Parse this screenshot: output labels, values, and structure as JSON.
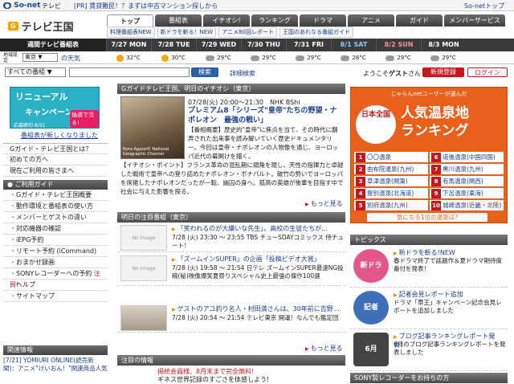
{
  "topbar": {
    "logo": "So-net",
    "tv": "テレビ",
    "pr": "[PR] 賃貸難民！？まずは中古マンション探しから",
    "right_link": "So-netトップ"
  },
  "brand": {
    "badge": "G",
    "name": "テレビ王国"
  },
  "nav": {
    "tabs": [
      "トップ",
      "番組表",
      "イチオシ!",
      "ランキング",
      "ドラマ",
      "アニメ",
      "ガイド",
      "メンバーサービス"
    ]
  },
  "subnav": {
    "items": [
      "料理番組表NEW",
      "新ドラを斬る！NEW",
      "アニメ80回レポート",
      "王国のあれなる番組ガイド"
    ]
  },
  "week": {
    "caption": "週間テレビ番組表",
    "days": [
      {
        "date": "7/27",
        "dow": "MON",
        "type": "wk"
      },
      {
        "date": "7/28",
        "dow": "TUE",
        "type": "wk"
      },
      {
        "date": "7/29",
        "dow": "WED",
        "type": "wk"
      },
      {
        "date": "7/30",
        "dow": "THU",
        "type": "wk"
      },
      {
        "date": "7/31",
        "dow": "FRI",
        "type": "wk"
      },
      {
        "date": "8/1",
        "dow": "SAT",
        "type": "sat"
      },
      {
        "date": "8/2",
        "dow": "SUN",
        "type": "sun"
      },
      {
        "date": "8/3",
        "dow": "MON",
        "type": "wk"
      }
    ]
  },
  "weather": {
    "area_label": "地域設定",
    "area": "東京",
    "link": "の天気",
    "temps": [
      "32°C",
      "30°C",
      "29°C",
      "29°C",
      "29°C",
      "28°C",
      "29°C",
      "29°C"
    ],
    "icons": [
      "sun-icon",
      "sun-icon",
      "cloud-icon",
      "cloud-icon",
      "cloud-icon",
      "cloud-icon",
      "cloud-icon",
      "cloud-icon"
    ]
  },
  "search": {
    "scope": "すべての番組",
    "button": "検索",
    "advanced": "詳細検索",
    "welcome_prefix": "ようこそ",
    "welcome_name": "ゲスト",
    "welcome_suffix": "さん",
    "register": "新規登録",
    "login": "ログイン"
  },
  "left": {
    "banner": {
      "line1": "リニューアル",
      "line2": "キャンペーン",
      "tag": "抽選で当る!",
      "small": "応募締切 8/31"
    },
    "banner_link": "番組表が新しくなりました",
    "guide_title": "Gガイド・テレビ王国とは？",
    "info_items": [
      "初めての方へ",
      "現在ご利用の皆さまへ"
    ],
    "usage_title": "ご利用ガイド",
    "usage_items": [
      "Gガイド・テレビ王国概要",
      "動作環境と番組表の使い方",
      "メンバーとゲストの違い",
      "対応機器の確認",
      "iEPG予約",
      "リモート予約 (iCommand)",
      "おまかせ録画",
      "SONYレコーダーへの予約",
      "ヘルプ",
      "サイトマップ"
    ],
    "usage_hot": "注目!",
    "news_title": "関連情報",
    "news": "[7/21] YOMIURI ONLINE(読売新聞)：アニメ\"けいおん！\"関連商品人気"
  },
  "center": {
    "feature_title": "Gガイドテレビ王国、明日のイチオシ（東京）",
    "feature_meta": "07/28(火) 20:00～21:30　NHK BShi",
    "feature_prog": "プレミアム8「シリーズ\"皇帝\"たちの野望・ナポレオン　最強の戦い」",
    "feature_caption": "Nora Agazzi© National Geographic Channel",
    "feature_body": "【番組概要】歴史的\"皇帝\"に焦点を当て、その時代に翻弄された出来事を読み解いていく歴史ドキュメンタリー。今回は皇帝・ナポレオンの人物像を通じ、ヨーロッパ近代の幕開けを描く。",
    "feature_body2": "【イチオシ・ポイント】フランス革命の混乱期に頭角を現し、天性の指揮力と卓越した戦術で皇帝への登り詰めたナポレオン・ボナパルト。破竹の勢いでヨーロッパを席捲したナポレオンだったが一転、幽囚の身へ。孤高の英雄が後輩を目指す中で社会に与えた影響を探る。",
    "more": "もっと見る",
    "tomorrow_title": "明日の注目番組（東京）",
    "noimage": "No Image",
    "progs": [
      {
        "title": "「笑われるのが大嫌いな先生」。高校の生徒たちが…",
        "meta": "7/28 (火) 23:30 ～ 23:55 TBS チューSDAYコミックス 侍チュート！",
        "badge": "iEPG"
      },
      {
        "title": "「ズームインSUPER」の企画「投稿ビデオ大賞」",
        "meta": "7/28 (火) 19:58 ～ 21:54 日テレ ズームインSUPER最速NG投稿(秘)映像爆笑夏祭りスペシャル史上最強の傑作100選",
        "badge": "iEPG"
      },
      {
        "title": "ゲストのアユ釣り名人・村田満さんは、30年前に吉野…",
        "meta": "7/28 (火) 20:54 ～ 21:54 テレビ東京 開運！なんでも鑑定団",
        "badge": "iEPG"
      }
    ],
    "notice_title": "注目の情報",
    "notice1": "掲統会員様、8月末まで完全無料!",
    "notice2": "ギネス世界記録のすごさを体感しよう!"
  },
  "right": {
    "onsen_head": "じゃらんnetユーザーが選んだ",
    "onsen_seal": "日本全国",
    "onsen_big1": "人気温泉地",
    "onsen_big2": "ランキング",
    "ranks": [
      {
        "n": "1",
        "name": "〇〇温泉"
      },
      {
        "n": "6",
        "name": "道後温泉(中国四国)"
      },
      {
        "n": "2",
        "name": "由布院温泉(九州)"
      },
      {
        "n": "7",
        "name": "黒川温泉(九州)"
      },
      {
        "n": "3",
        "name": "草津温泉(関東)"
      },
      {
        "n": "8",
        "name": "有馬温泉(関西)"
      },
      {
        "n": "4",
        "name": "登別温泉(北海道)"
      },
      {
        "n": "9",
        "name": "下呂温泉(東海)"
      },
      {
        "n": "5",
        "name": "別府温泉(九州)"
      },
      {
        "n": "10",
        "name": "城崎温泉(近畿・北陸)"
      }
    ],
    "onsen_foot": "気になる1位の温泉は?",
    "topics_title": "トピックス",
    "topics": [
      {
        "icon": "新ドラ",
        "color": "#e2568b",
        "title": "新ドラを斬る!NEW",
        "body": "春ドラマ終了で話題作＆夏ドラマ期待度番付を発表！"
      },
      {
        "icon": "記者",
        "color": "#3f6fb8",
        "title": "記者会見レポート追加",
        "body": "ドラマ「帯王」キャンペーン記念会見レポートを追加しました"
      },
      {
        "icon": "6月",
        "color": "#444",
        "title": "ブログ記事ランキングレポート発表！",
        "body": "6月のブログ記事ランキングレポートを発表しました"
      }
    ],
    "sony_title": "SONY製レコーダーをお持ちの方"
  }
}
